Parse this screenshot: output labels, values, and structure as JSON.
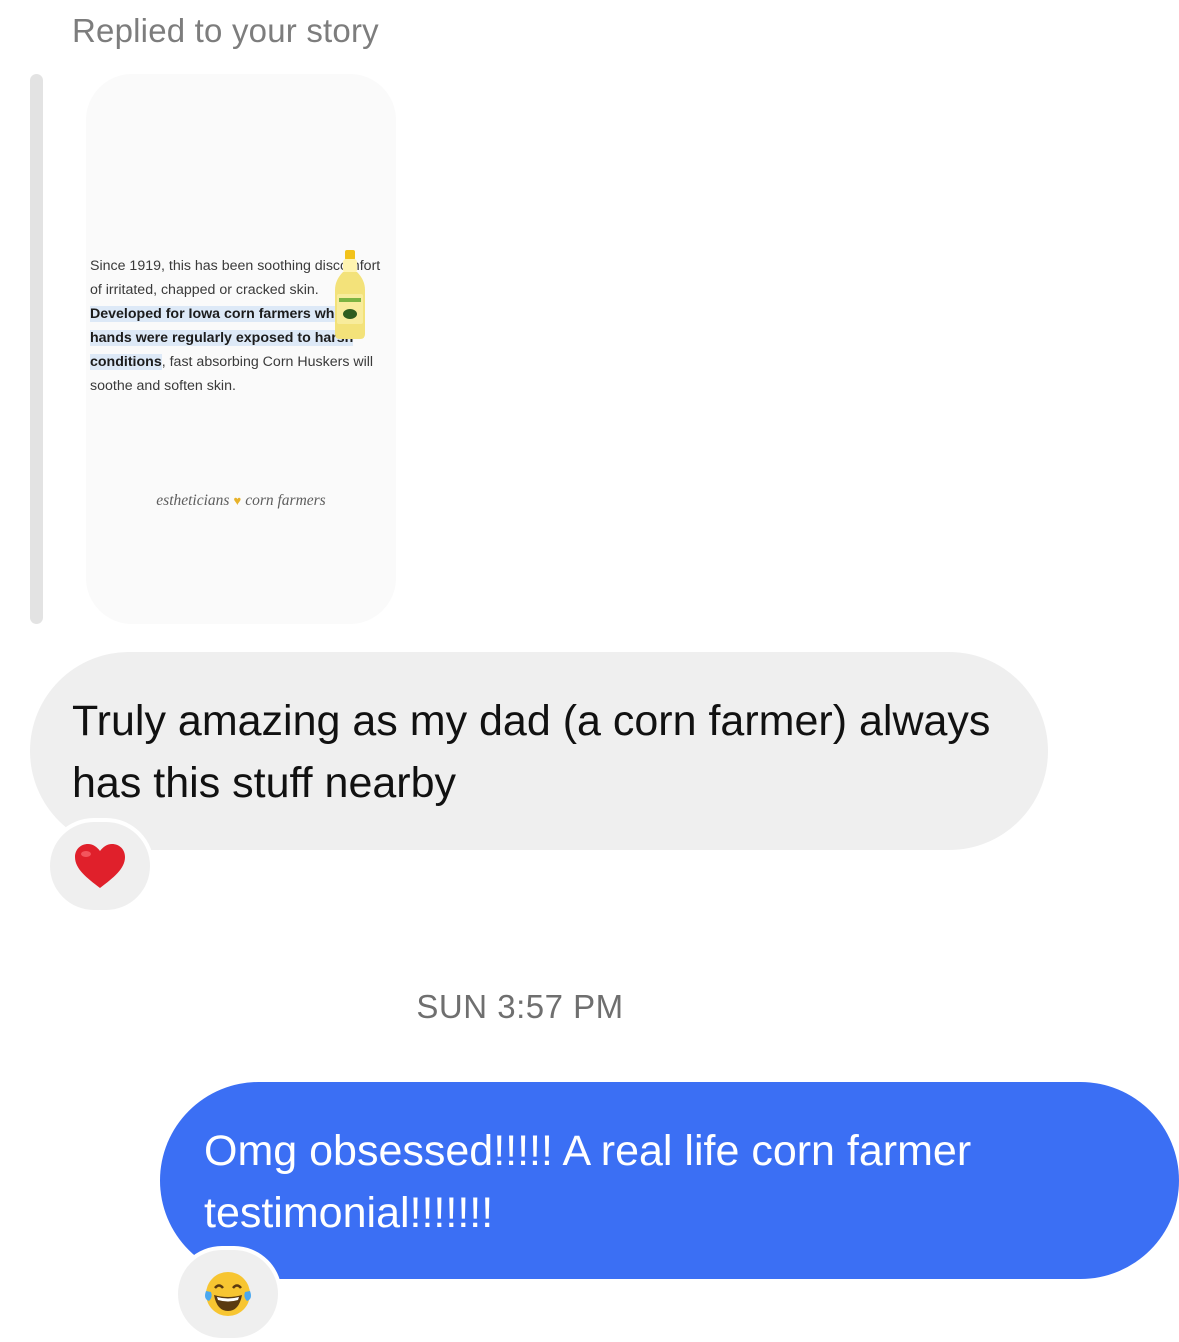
{
  "reply_label": "Replied to your story",
  "story": {
    "text_plain_1": "Since 1919, this has been soothing discomfort of irritated, chapped or cracked skin. ",
    "text_highlight": "Developed for Iowa corn farmers whose hands were regularly exposed to harsh conditions",
    "text_plain_2": ", fast absorbing Corn Huskers will soothe and soften skin.",
    "tagline_left": "estheticians",
    "tagline_right": "corn farmers",
    "tagline_icon": "handshake-icon"
  },
  "messages": {
    "incoming": {
      "text": "Truly amazing as my dad (a corn farmer) always has this stuff nearby",
      "reaction_icon": "red-heart-icon"
    },
    "timestamp": "SUN 3:57 PM",
    "outgoing": {
      "text": "Omg obsessed!!!!! A real life corn farmer testimonial!!!!!!!",
      "reaction_icon": "laughing-tears-icon"
    }
  },
  "colors": {
    "outgoing_bubble": "#3b6ff4",
    "incoming_bubble": "#efefef",
    "heart": "#e0202b"
  }
}
